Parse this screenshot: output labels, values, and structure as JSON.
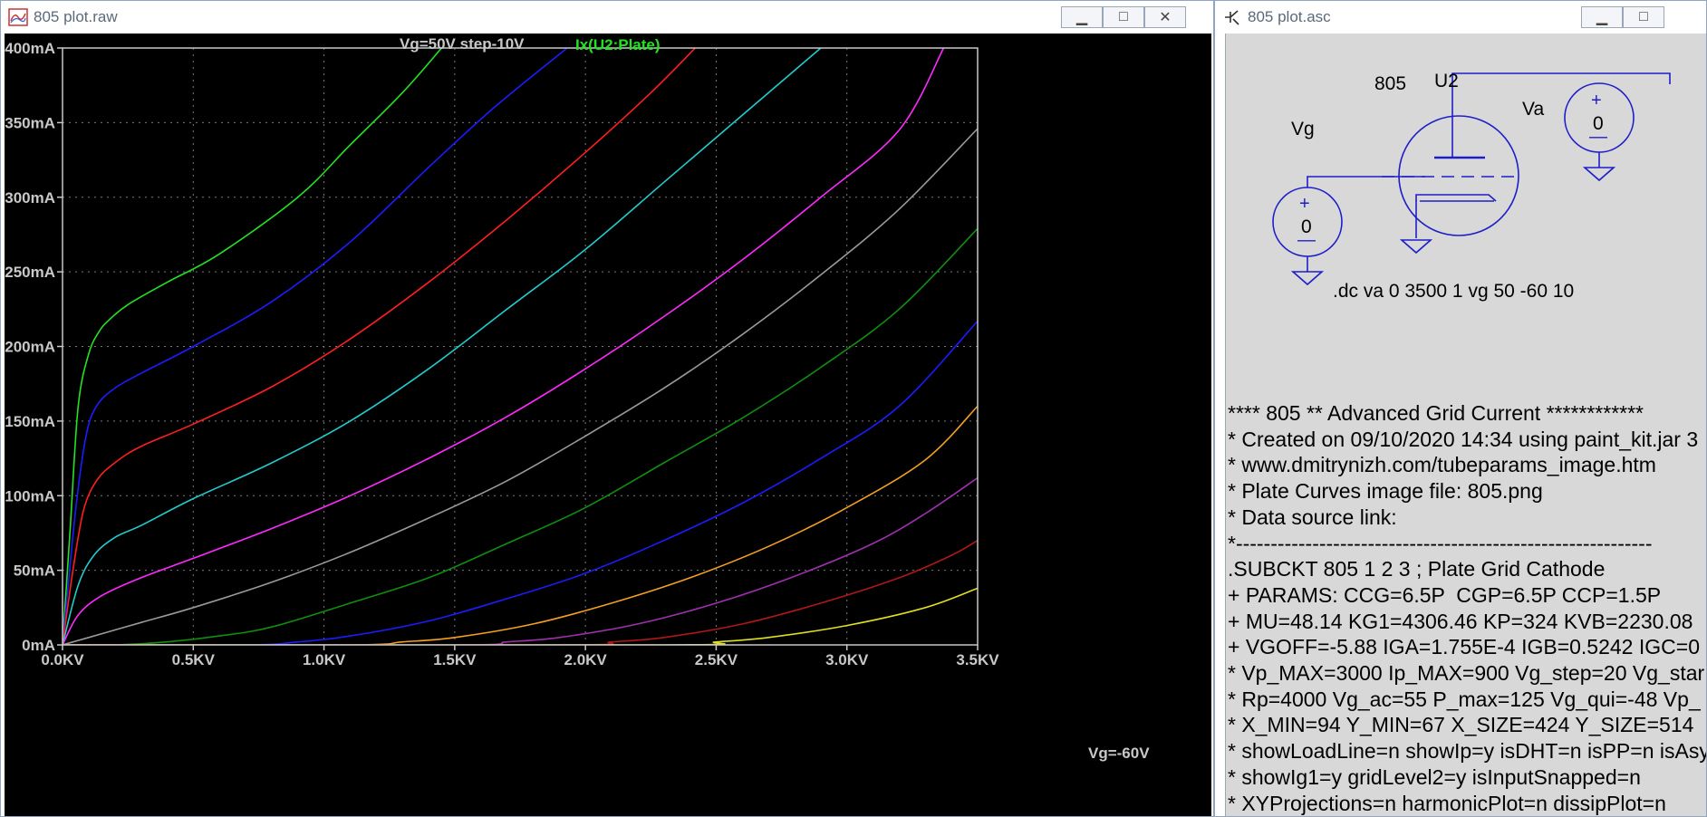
{
  "plot_window": {
    "title": "805 plot.raw",
    "buttons": {
      "minimize": "▁",
      "maximize": "□",
      "close": "✕"
    }
  },
  "schematic_window": {
    "title": "805 plot.asc",
    "buttons": {
      "minimize": "▁",
      "maximize": "□"
    },
    "labels": {
      "tube_value": "805",
      "tube_ref": "U2",
      "vg_name": "Vg",
      "va_name": "Va",
      "vg_value": "0",
      "va_value": "0",
      "directive": ".dc va 0 3500 1 vg 50 -60 10"
    },
    "netlist": [
      "**** 805 ** Advanced Grid Current ************",
      "* Created on 09/10/2020 14:34 using paint_kit.jar 3",
      "* www.dmitrynizh.com/tubeparams_image.htm",
      "* Plate Curves image file: 805.png",
      "* Data source link:",
      "*------------------------------------------------------------",
      ".SUBCKT 805 1 2 3 ; Plate Grid Cathode",
      "+ PARAMS: CCG=6.5P  CGP=6.5P CCP=1.5P",
      "+ MU=48.14 KG1=4306.46 KP=324 KVB=2230.08",
      "+ VGOFF=-5.88 IGA=1.755E-4 IGB=0.5242 IGC=0",
      "* Vp_MAX=3000 Ip_MAX=900 Vg_step=20 Vg_star",
      "* Rp=4000 Vg_ac=55 P_max=125 Vg_qui=-48 Vp_",
      "* X_MIN=94 Y_MIN=67 X_SIZE=424 Y_SIZE=514",
      "* showLoadLine=n showIp=y isDHT=n isPP=n isAsy",
      "* showIg1=y gridLevel2=y isInputSnapped=n",
      "* XYProjections=n harmonicPlot=n dissipPlot=n"
    ]
  },
  "colors": {
    "plot_bg": "#000000",
    "grid": "#7a7a7a",
    "axis_text": "#c8c8c8",
    "schematic_bg": "#d8d8d8",
    "wire": "#1e1ec8"
  },
  "chart_data": {
    "type": "line",
    "title": "",
    "header_labels": [
      "Vg=50V step-10V",
      "Ix(U2:Plate)"
    ],
    "xlabel": "",
    "ylabel": "",
    "xlim": [
      0,
      3500
    ],
    "ylim": [
      0,
      400
    ],
    "x_unit": "V",
    "y_unit": "mA",
    "grid": true,
    "x_ticks": [
      "0.0KV",
      "0.5KV",
      "1.0KV",
      "1.5KV",
      "2.0KV",
      "2.5KV",
      "3.0KV",
      "3.5KV"
    ],
    "y_ticks": [
      "0mA",
      "50mA",
      "100mA",
      "150mA",
      "200mA",
      "250mA",
      "300mA",
      "350mA",
      "400mA"
    ],
    "annotation": "Vg=-60V",
    "series": [
      {
        "vg": 50,
        "color": "#22e322",
        "x": [
          0,
          30,
          60,
          100,
          140,
          180,
          250,
          400,
          600,
          900,
          1100,
          1300,
          1450
        ],
        "y": [
          0,
          80,
          160,
          195,
          210,
          218,
          228,
          243,
          262,
          300,
          335,
          370,
          400
        ]
      },
      {
        "vg": 40,
        "color": "#1c1cff",
        "x": [
          0,
          50,
          90,
          130,
          200,
          300,
          500,
          800,
          1100,
          1400,
          1650,
          1930
        ],
        "y": [
          0,
          90,
          140,
          160,
          172,
          182,
          200,
          230,
          270,
          320,
          360,
          400
        ]
      },
      {
        "vg": 30,
        "color": "#ff1f1f",
        "x": [
          0,
          40,
          80,
          130,
          200,
          300,
          500,
          800,
          1100,
          1400,
          1700,
          2000,
          2250,
          2420
        ],
        "y": [
          0,
          50,
          90,
          110,
          122,
          133,
          148,
          173,
          205,
          243,
          285,
          330,
          370,
          400
        ]
      },
      {
        "vg": 20,
        "color": "#22cccc",
        "x": [
          0,
          60,
          120,
          200,
          300,
          500,
          800,
          1100,
          1400,
          1700,
          2000,
          2300,
          2600,
          2900
        ],
        "y": [
          0,
          40,
          60,
          72,
          80,
          98,
          122,
          150,
          185,
          225,
          265,
          310,
          355,
          400
        ]
      },
      {
        "vg": 10,
        "color": "#ff2aff",
        "x": [
          0,
          60,
          150,
          300,
          500,
          800,
          1100,
          1400,
          1700,
          2000,
          2300,
          2600,
          2900,
          3200,
          3370
        ],
        "y": [
          0,
          20,
          33,
          45,
          58,
          78,
          100,
          125,
          153,
          185,
          220,
          258,
          300,
          345,
          400
        ]
      },
      {
        "vg": 0,
        "color": "#9a9a9a",
        "x": [
          0,
          100,
          300,
          500,
          800,
          1100,
          1400,
          1700,
          2000,
          2300,
          2600,
          2900,
          3200,
          3500
        ],
        "y": [
          0,
          5,
          15,
          25,
          42,
          62,
          85,
          110,
          140,
          172,
          208,
          248,
          292,
          346
        ]
      },
      {
        "vg": -10,
        "color": "#0f8f0f",
        "x": [
          0,
          200,
          400,
          600,
          800,
          1100,
          1400,
          1700,
          2000,
          2300,
          2600,
          2900,
          3200,
          3500
        ],
        "y": [
          0,
          0,
          2,
          6,
          12,
          28,
          45,
          68,
          92,
          122,
          152,
          186,
          225,
          279
        ]
      },
      {
        "vg": -20,
        "color": "#1c1cff",
        "x": [
          0,
          700,
          900,
          1100,
          1400,
          1700,
          2000,
          2300,
          2600,
          2900,
          3200,
          3500
        ],
        "y": [
          0,
          0,
          2,
          6,
          16,
          31,
          48,
          70,
          95,
          125,
          160,
          217
        ]
      },
      {
        "vg": -30,
        "color": "#f4a020",
        "x": [
          0,
          1100,
          1300,
          1500,
          1800,
          2100,
          2400,
          2700,
          3000,
          3300,
          3500
        ],
        "y": [
          0,
          0,
          2,
          5,
          14,
          28,
          45,
          66,
          92,
          124,
          160
        ]
      },
      {
        "vg": -40,
        "color": "#a030b0",
        "x": [
          0,
          1500,
          1700,
          1900,
          2200,
          2500,
          2800,
          3100,
          3300,
          3500
        ],
        "y": [
          0,
          0,
          2,
          5,
          14,
          28,
          46,
          68,
          88,
          112
        ]
      },
      {
        "vg": -50,
        "color": "#b01818",
        "x": [
          0,
          1900,
          2100,
          2300,
          2600,
          2900,
          3200,
          3400,
          3500
        ],
        "y": [
          0,
          0,
          2,
          5,
          14,
          28,
          45,
          60,
          70
        ]
      },
      {
        "vg": -60,
        "color": "#e0e020",
        "x": [
          0,
          2300,
          2500,
          2700,
          3000,
          3300,
          3500
        ],
        "y": [
          0,
          0,
          2,
          5,
          13,
          25,
          38
        ]
      }
    ]
  }
}
